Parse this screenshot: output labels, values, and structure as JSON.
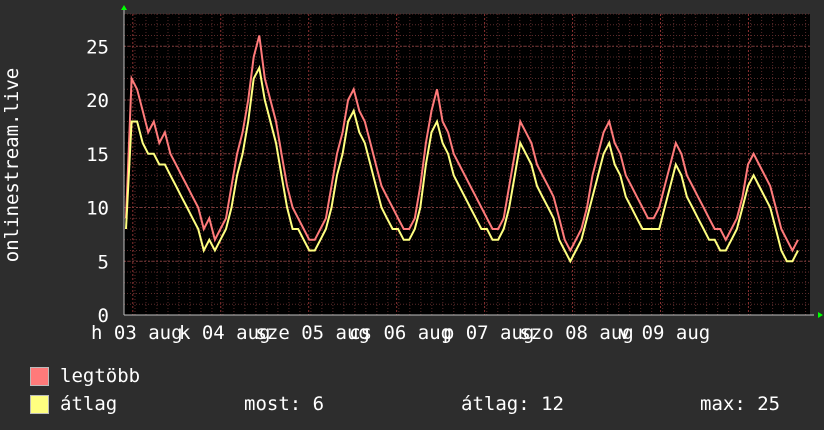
{
  "chart_data": {
    "type": "line",
    "ylabel": "onlinestream.live",
    "ylim": [
      0,
      28
    ],
    "yticks": [
      0,
      5,
      10,
      15,
      20,
      25
    ],
    "xticks": [
      "h 03 aug",
      "k 04 aug",
      "sze 05 aug",
      "cs 06 aug",
      "p 07 aug",
      "szo 08 aug",
      "v 09 aug"
    ],
    "grid": true,
    "colors": {
      "background": "#000000",
      "grid": "#5a2a2a",
      "axis": "#c0c0c0",
      "arrow": "#00ff00"
    },
    "series": [
      {
        "name": "legtöbb",
        "color": "#ff7a7a",
        "values": [
          9,
          22,
          21,
          19,
          17,
          18,
          16,
          17,
          15,
          14,
          13,
          12,
          11,
          10,
          8,
          9,
          7,
          8,
          9,
          12,
          15,
          17,
          20,
          24,
          26,
          22,
          20,
          18,
          15,
          12,
          10,
          9,
          8,
          7,
          7,
          8,
          9,
          12,
          15,
          17,
          20,
          21,
          19,
          18,
          16,
          14,
          12,
          11,
          10,
          9,
          8,
          8,
          9,
          12,
          16,
          19,
          21,
          18,
          17,
          15,
          14,
          13,
          12,
          11,
          10,
          9,
          8,
          8,
          9,
          12,
          15,
          18,
          17,
          16,
          14,
          13,
          12,
          11,
          9,
          7,
          6,
          7,
          8,
          10,
          13,
          15,
          17,
          18,
          16,
          15,
          13,
          12,
          11,
          10,
          9,
          9,
          10,
          12,
          14,
          16,
          15,
          13,
          12,
          11,
          10,
          9,
          8,
          8,
          7,
          8,
          9,
          11,
          14,
          15,
          14,
          13,
          12,
          10,
          8,
          7,
          6,
          7
        ]
      },
      {
        "name": "átlag",
        "color": "#ffff80",
        "values": [
          8,
          18,
          18,
          16,
          15,
          15,
          14,
          14,
          13,
          12,
          11,
          10,
          9,
          8,
          6,
          7,
          6,
          7,
          8,
          10,
          13,
          15,
          18,
          22,
          23,
          20,
          18,
          16,
          13,
          10,
          8,
          8,
          7,
          6,
          6,
          7,
          8,
          10,
          13,
          15,
          18,
          19,
          17,
          16,
          14,
          12,
          10,
          9,
          8,
          8,
          7,
          7,
          8,
          10,
          14,
          17,
          18,
          16,
          15,
          13,
          12,
          11,
          10,
          9,
          8,
          8,
          7,
          7,
          8,
          10,
          13,
          16,
          15,
          14,
          12,
          11,
          10,
          9,
          7,
          6,
          5,
          6,
          7,
          9,
          11,
          13,
          15,
          16,
          14,
          13,
          11,
          10,
          9,
          8,
          8,
          8,
          8,
          10,
          12,
          14,
          13,
          11,
          10,
          9,
          8,
          7,
          7,
          6,
          6,
          7,
          8,
          10,
          12,
          13,
          12,
          11,
          10,
          8,
          6,
          5,
          5,
          6
        ]
      }
    ]
  },
  "legend": {
    "items": [
      {
        "label": "legtöbb",
        "color": "#ff7a7a"
      },
      {
        "label": "átlag",
        "color": "#ffff80"
      }
    ],
    "stats": {
      "now": "most: 6",
      "avg": "átlag: 12",
      "max": "max: 25"
    }
  }
}
